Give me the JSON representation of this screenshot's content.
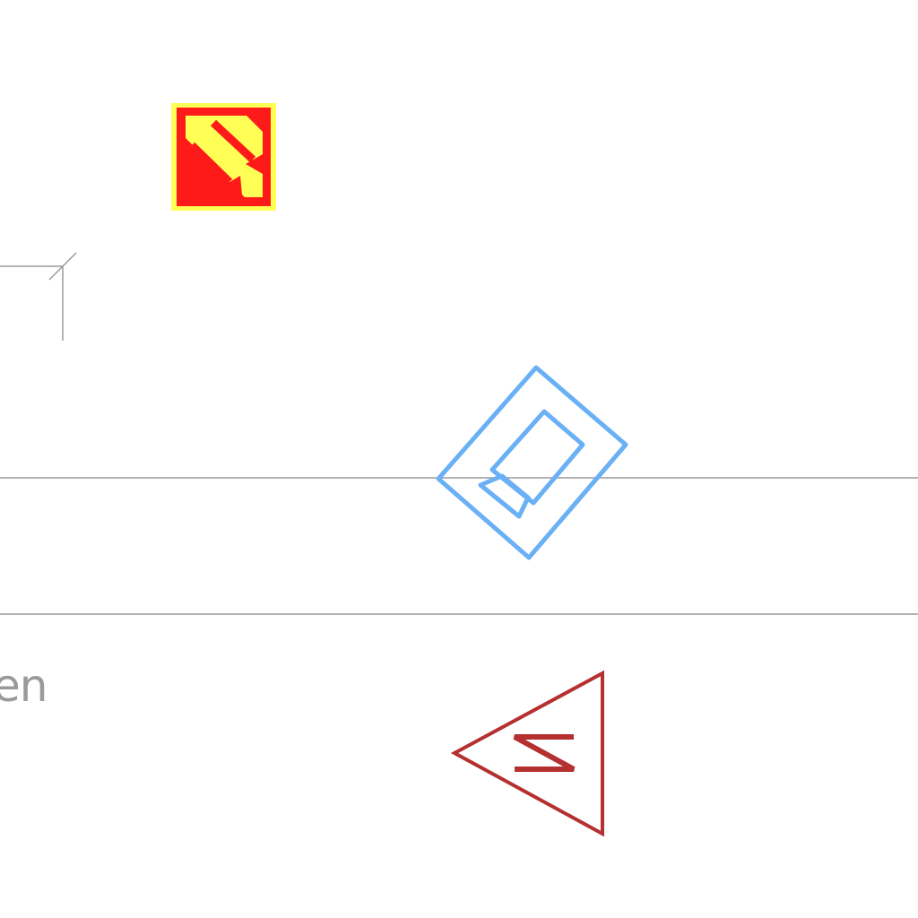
{
  "map": {
    "room_label_fragment": "en",
    "symbols": [
      {
        "name": "fire-hose-reel-icon",
        "colors": {
          "fill": "#ff1a1a",
          "background": "#ffff55"
        }
      },
      {
        "name": "camera-icon",
        "colors": {
          "stroke": "#6ab0f5"
        }
      },
      {
        "name": "north-arrow-icon",
        "letter": "N",
        "colors": {
          "stroke": "#b53030"
        }
      }
    ],
    "line_color": "#9a9a9a"
  }
}
